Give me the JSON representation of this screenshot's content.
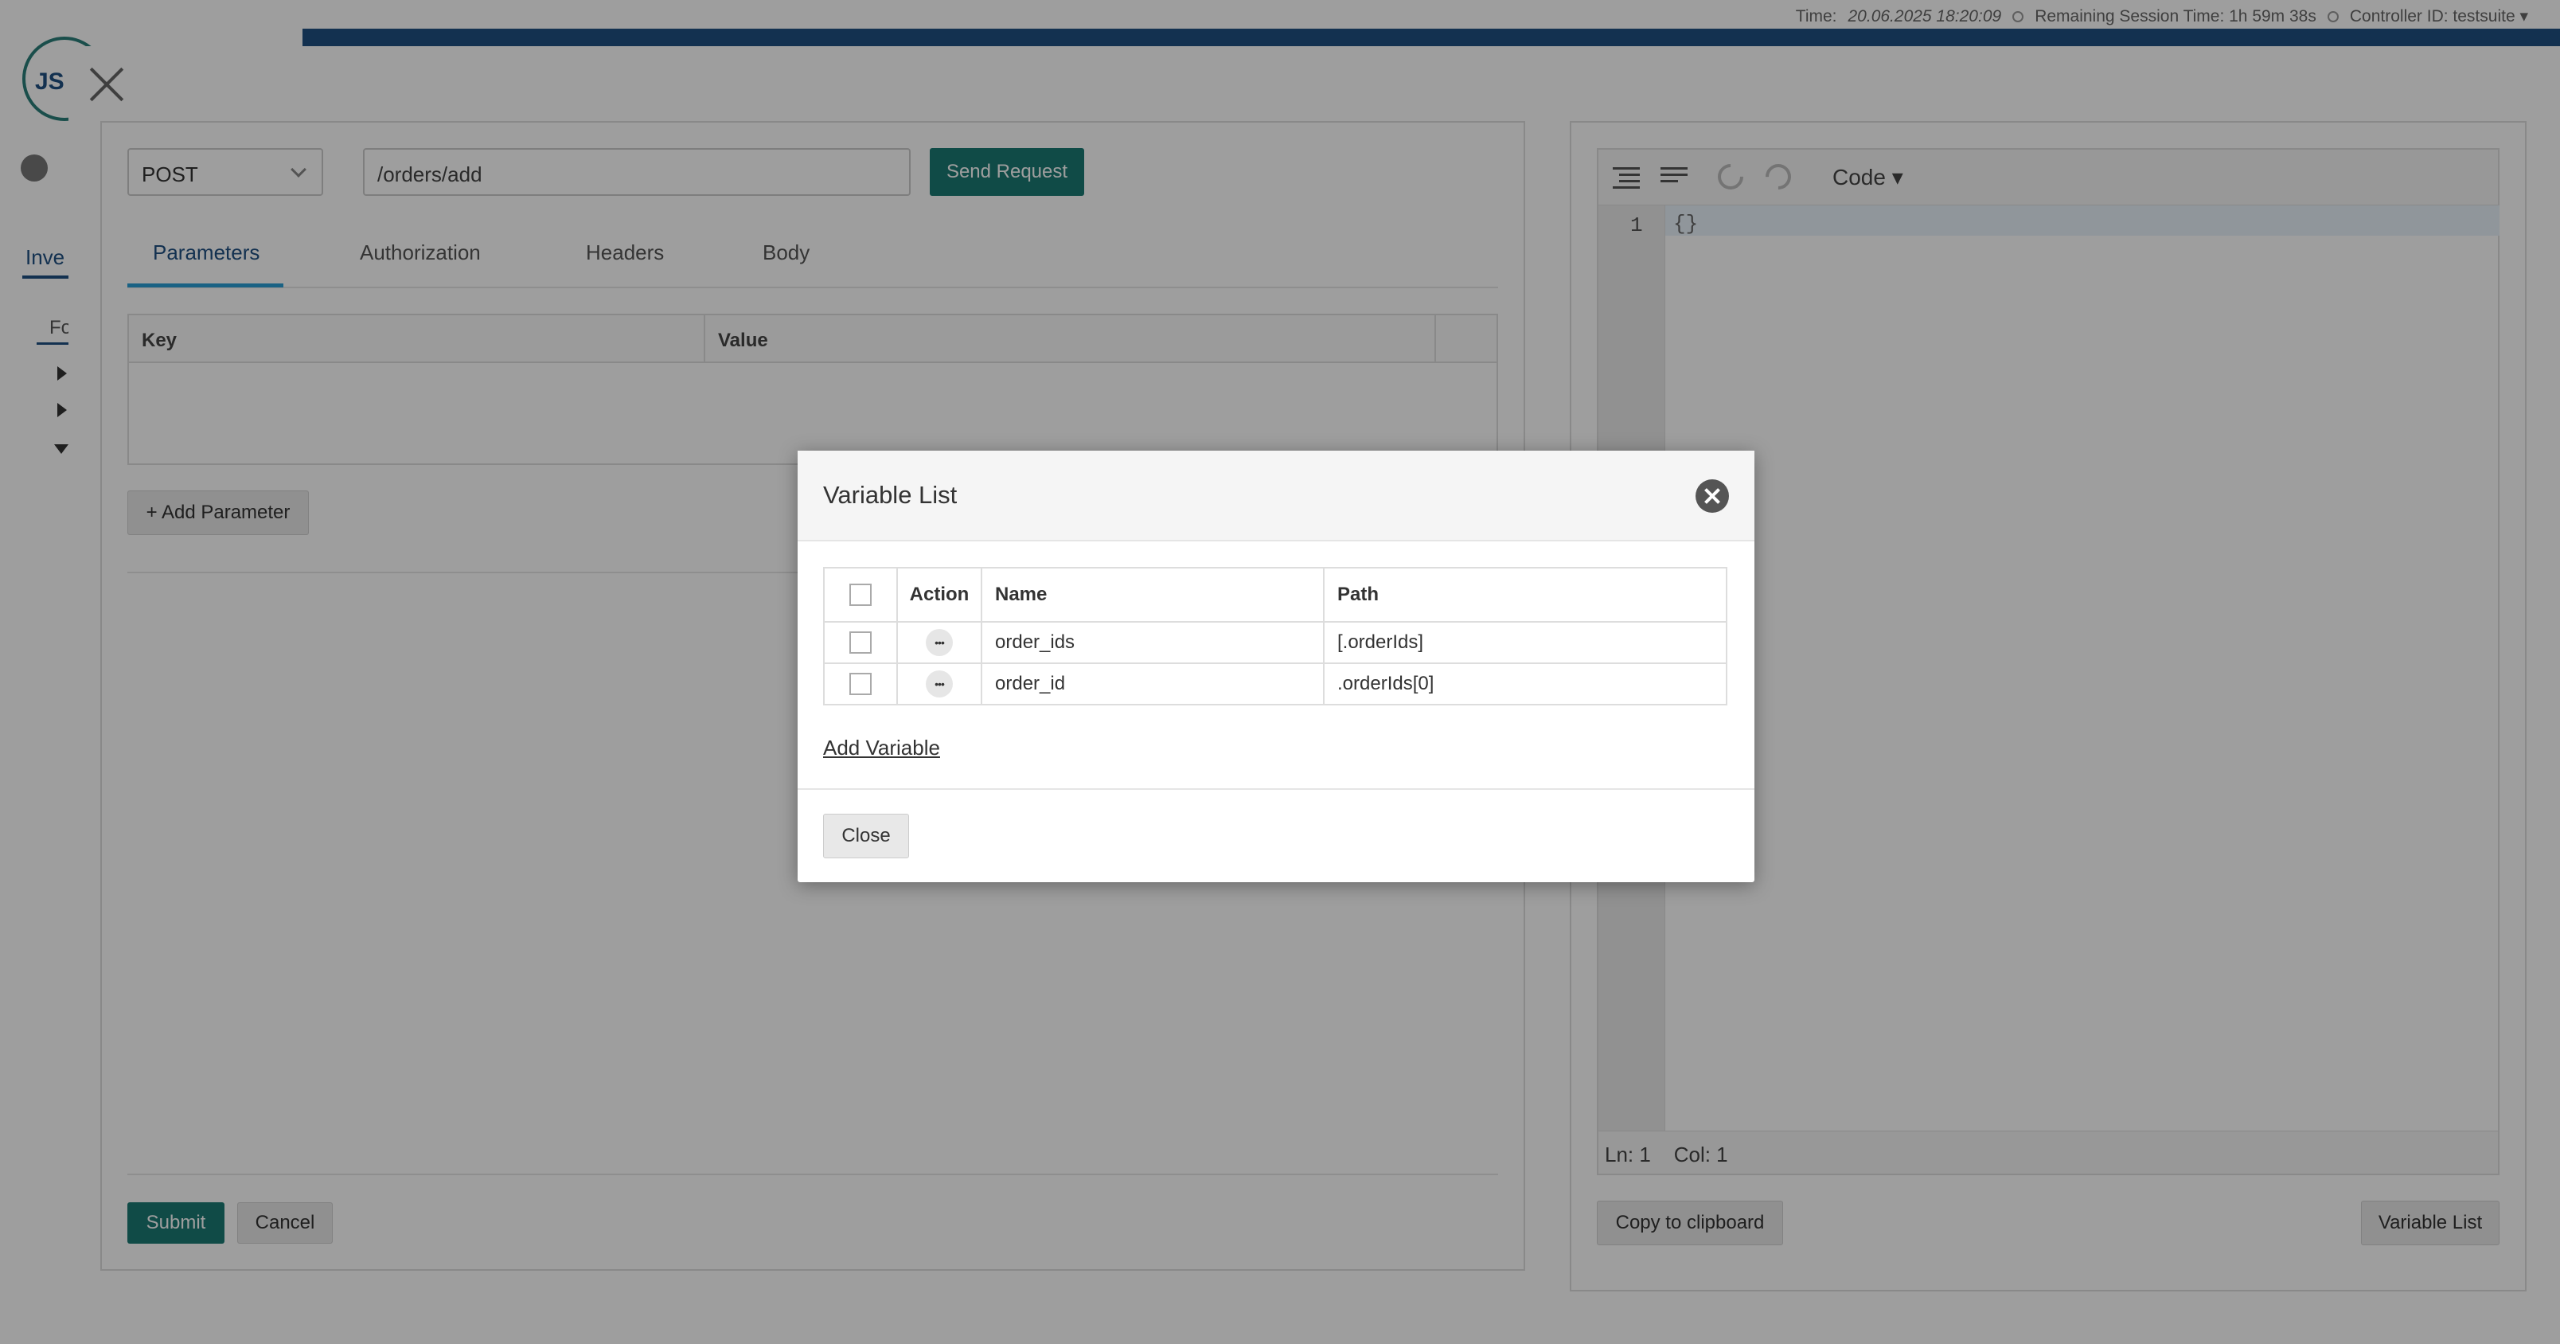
{
  "topbar": {
    "time_label": "Time:",
    "time_value": "20.06.2025 18:20:09",
    "session_label": "Remaining Session Time: 1h 59m 38s",
    "controller_label": "Controller ID: testsuite ▾"
  },
  "background": {
    "logo_text": "JS",
    "tab_inventory": "Inve",
    "tab_fo": "Fo"
  },
  "request": {
    "method": "POST",
    "url": "/orders/add",
    "send_label": "Send Request",
    "tabs": [
      "Parameters",
      "Authorization",
      "Headers",
      "Body"
    ],
    "active_tab": "Parameters",
    "param_columns": [
      "Key",
      "Value"
    ],
    "add_parameter_label": "+ Add Parameter",
    "submit_label": "Submit",
    "cancel_label": "Cancel"
  },
  "editor": {
    "mode_label": "Code ▾",
    "line_number": "1",
    "content": "{}",
    "status": "Ln: 1    Col: 1",
    "copy_label": "Copy to clipboard",
    "variable_list_label": "Variable List"
  },
  "modal": {
    "title": "Variable List",
    "columns": [
      "Action",
      "Name",
      "Path"
    ],
    "rows": [
      {
        "name": "order_ids",
        "path": "[.orderIds]"
      },
      {
        "name": "order_id",
        "path": ".orderIds[0]"
      }
    ],
    "add_variable_label": "Add Variable",
    "close_label": "Close"
  }
}
